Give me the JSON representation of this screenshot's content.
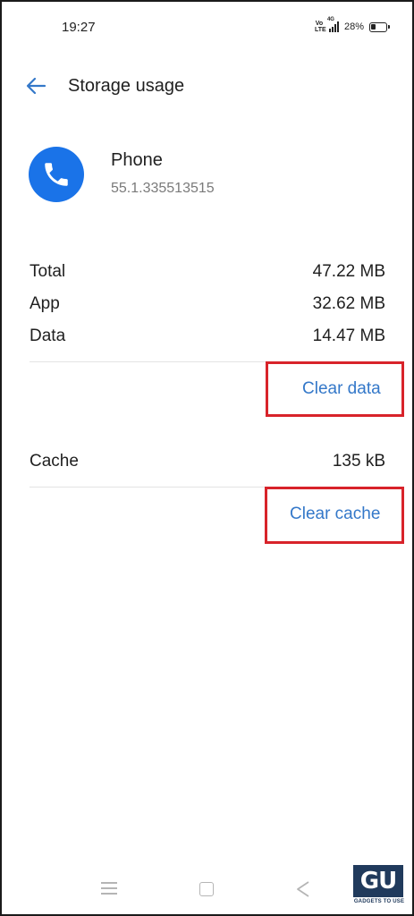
{
  "status_bar": {
    "time": "19:27",
    "volte": "Vo LTE",
    "network": "4G",
    "battery": "28%"
  },
  "header": {
    "title": "Storage usage",
    "back_icon": "arrow-left-icon"
  },
  "app": {
    "name": "Phone",
    "version": "55.1.335513515",
    "icon": "phone-handset-icon",
    "icon_color": "#1a73e8"
  },
  "storage": {
    "rows": [
      {
        "label": "Total",
        "value": "47.22 MB"
      },
      {
        "label": "App",
        "value": "32.62 MB"
      },
      {
        "label": "Data",
        "value": "14.47 MB"
      }
    ],
    "clear_data_label": "Clear data"
  },
  "cache": {
    "label": "Cache",
    "value": "135 kB",
    "clear_cache_label": "Clear cache"
  },
  "colors": {
    "accent": "#3478c9",
    "highlight_box": "#d8232a"
  },
  "watermark": {
    "logo": "GU",
    "text": "GADGETS TO USE"
  }
}
